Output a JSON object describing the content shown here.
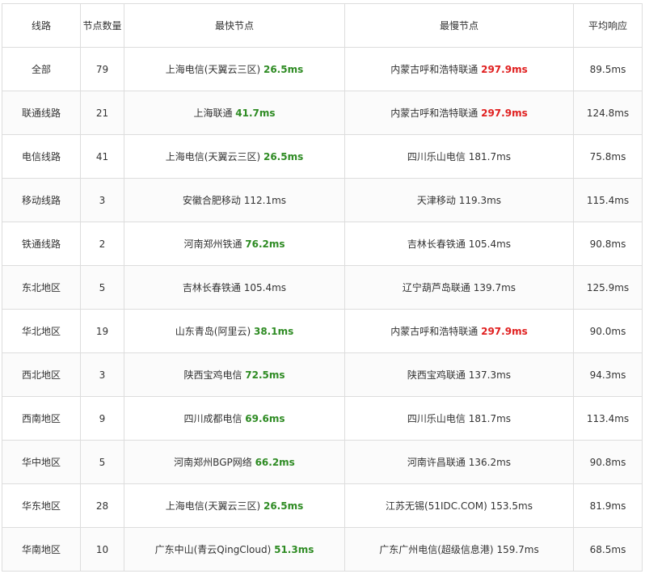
{
  "colors": {
    "fast": "#2e8b23",
    "slow": "#e02020",
    "text": "#333333",
    "border": "#dddddd"
  },
  "table": {
    "headers": [
      "线路",
      "节点数量",
      "最快节点",
      "最慢节点",
      "平均响应"
    ],
    "rows": [
      {
        "route": "全部",
        "count": "79",
        "fastest_node": "上海电信(天翼云三区)",
        "fastest_time": "26.5ms",
        "fastest_style": "fast",
        "slowest_node": "内蒙古呼和浩特联通",
        "slowest_time": "297.9ms",
        "slowest_style": "slow",
        "average": "89.5ms"
      },
      {
        "route": "联通线路",
        "count": "21",
        "fastest_node": "上海联通",
        "fastest_time": "41.7ms",
        "fastest_style": "fast",
        "slowest_node": "内蒙古呼和浩特联通",
        "slowest_time": "297.9ms",
        "slowest_style": "slow",
        "average": "124.8ms"
      },
      {
        "route": "电信线路",
        "count": "41",
        "fastest_node": "上海电信(天翼云三区)",
        "fastest_time": "26.5ms",
        "fastest_style": "fast",
        "slowest_node": "四川乐山电信",
        "slowest_time": "181.7ms",
        "slowest_style": "plain",
        "average": "75.8ms"
      },
      {
        "route": "移动线路",
        "count": "3",
        "fastest_node": "安徽合肥移动",
        "fastest_time": "112.1ms",
        "fastest_style": "plain",
        "slowest_node": "天津移动",
        "slowest_time": "119.3ms",
        "slowest_style": "plain",
        "average": "115.4ms"
      },
      {
        "route": "铁通线路",
        "count": "2",
        "fastest_node": "河南郑州铁通",
        "fastest_time": "76.2ms",
        "fastest_style": "fast",
        "slowest_node": "吉林长春铁通",
        "slowest_time": "105.4ms",
        "slowest_style": "plain",
        "average": "90.8ms"
      },
      {
        "route": "东北地区",
        "count": "5",
        "fastest_node": "吉林长春铁通",
        "fastest_time": "105.4ms",
        "fastest_style": "plain",
        "slowest_node": "辽宁葫芦岛联通",
        "slowest_time": "139.7ms",
        "slowest_style": "plain",
        "average": "125.9ms"
      },
      {
        "route": "华北地区",
        "count": "19",
        "fastest_node": "山东青岛(阿里云)",
        "fastest_time": "38.1ms",
        "fastest_style": "fast",
        "slowest_node": "内蒙古呼和浩特联通",
        "slowest_time": "297.9ms",
        "slowest_style": "slow",
        "average": "90.0ms"
      },
      {
        "route": "西北地区",
        "count": "3",
        "fastest_node": "陕西宝鸡电信",
        "fastest_time": "72.5ms",
        "fastest_style": "fast",
        "slowest_node": "陕西宝鸡联通",
        "slowest_time": "137.3ms",
        "slowest_style": "plain",
        "average": "94.3ms"
      },
      {
        "route": "西南地区",
        "count": "9",
        "fastest_node": "四川成都电信",
        "fastest_time": "69.6ms",
        "fastest_style": "fast",
        "slowest_node": "四川乐山电信",
        "slowest_time": "181.7ms",
        "slowest_style": "plain",
        "average": "113.4ms"
      },
      {
        "route": "华中地区",
        "count": "5",
        "fastest_node": "河南郑州BGP网络",
        "fastest_time": "66.2ms",
        "fastest_style": "fast",
        "slowest_node": "河南许昌联通",
        "slowest_time": "136.2ms",
        "slowest_style": "plain",
        "average": "90.8ms"
      },
      {
        "route": "华东地区",
        "count": "28",
        "fastest_node": "上海电信(天翼云三区)",
        "fastest_time": "26.5ms",
        "fastest_style": "fast",
        "slowest_node": "江苏无锡(51IDC.COM)",
        "slowest_time": "153.5ms",
        "slowest_style": "plain",
        "average": "81.9ms"
      },
      {
        "route": "华南地区",
        "count": "10",
        "fastest_node": "广东中山(青云QingCloud)",
        "fastest_time": "51.3ms",
        "fastest_style": "fast",
        "slowest_node": "广东广州电信(超级信息港)",
        "slowest_time": "159.7ms",
        "slowest_style": "plain",
        "average": "68.5ms"
      }
    ]
  }
}
